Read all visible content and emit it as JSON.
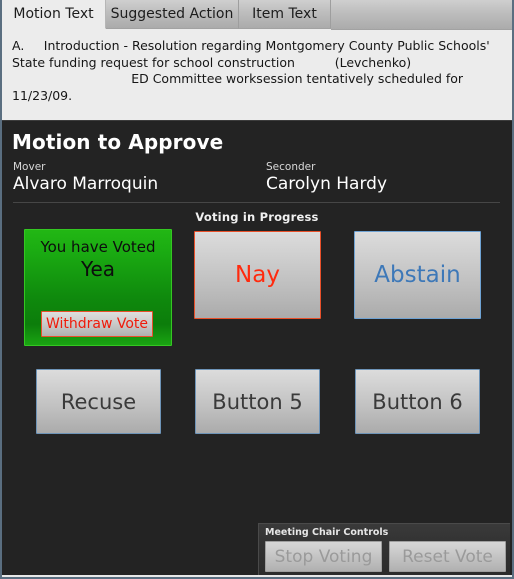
{
  "window": {
    "frame_color": "#5a6e80"
  },
  "tabs": [
    {
      "label": "Motion Text",
      "active": true
    },
    {
      "label": "Suggested Action",
      "active": false
    },
    {
      "label": "Item Text",
      "active": false
    }
  ],
  "motion_text": {
    "body": "A.\tIntroduction - Resolution regarding Montgomery County Public Schools' State funding request for school construction          (Levchenko)\n                              ED Committee worksession tentatively scheduled for 11/23/09."
  },
  "motion": {
    "title": "Motion to Approve",
    "mover_label": "Mover",
    "mover_name": "Alvaro Marroquin",
    "seconder_label": "Seconder",
    "seconder_name": "Carolyn Hardy",
    "status": "Voting in Progress"
  },
  "vote_buttons": {
    "yea": {
      "line1": "You have Voted",
      "line2": "Yea",
      "withdraw_label": "Withdraw Vote",
      "state": "selected",
      "fill_color": "#1bac12",
      "border_color": "#34c722",
      "text_color": "#0d0d0d"
    },
    "nay": {
      "label": "Nay",
      "text_color": "#ff2a0e",
      "border_color": "#e8502a"
    },
    "abstain": {
      "label": "Abstain",
      "text_color": "#3d78b8",
      "border_color": "#6fa3d4"
    },
    "recuse": {
      "label": "Recuse",
      "text_color": "#3a3a3a",
      "border_color": "#6e94b8"
    },
    "button5": {
      "label": "Button 5",
      "text_color": "#3a3a3a",
      "border_color": "#6e94b8"
    },
    "button6": {
      "label": "Button 6",
      "text_color": "#3a3a3a",
      "border_color": "#6e94b8"
    }
  },
  "chair_controls": {
    "title": "Meeting Chair Controls",
    "stop_voting_label": "Stop Voting",
    "reset_vote_label": "Reset Vote",
    "disabled_text_color": "#9a9a9a"
  }
}
